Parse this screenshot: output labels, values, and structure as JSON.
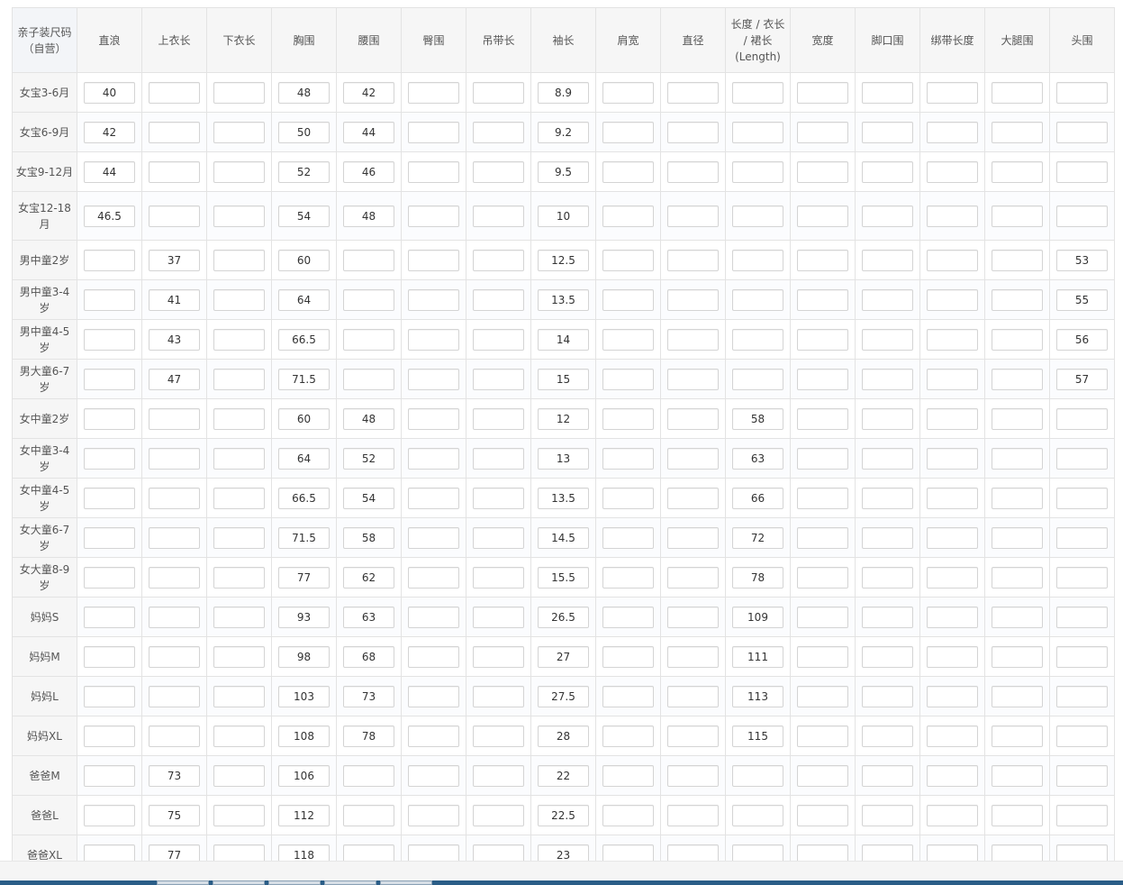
{
  "table": {
    "headers": [
      "亲子装尺码（自营）",
      "直浪",
      "上衣长",
      "下衣长",
      "胸围",
      "腰围",
      "臀围",
      "吊带长",
      "袖长",
      "肩宽",
      "直径",
      "长度 / 衣长 / 裙长 (Length)",
      "宽度",
      "脚口围",
      "绑带长度",
      "大腿围",
      "头围"
    ],
    "rows": [
      {
        "size": "女宝3-6月",
        "values": [
          "40",
          "",
          "",
          "48",
          "42",
          "",
          "",
          "8.9",
          "",
          "",
          "",
          "",
          "",
          "",
          "",
          ""
        ]
      },
      {
        "size": "女宝6-9月",
        "values": [
          "42",
          "",
          "",
          "50",
          "44",
          "",
          "",
          "9.2",
          "",
          "",
          "",
          "",
          "",
          "",
          "",
          ""
        ]
      },
      {
        "size": "女宝9-12月",
        "values": [
          "44",
          "",
          "",
          "52",
          "46",
          "",
          "",
          "9.5",
          "",
          "",
          "",
          "",
          "",
          "",
          "",
          ""
        ]
      },
      {
        "size": "女宝12-18月",
        "values": [
          "46.5",
          "",
          "",
          "54",
          "48",
          "",
          "",
          "10",
          "",
          "",
          "",
          "",
          "",
          "",
          "",
          ""
        ]
      },
      {
        "size": "男中童2岁",
        "values": [
          "",
          "37",
          "",
          "60",
          "",
          "",
          "",
          "12.5",
          "",
          "",
          "",
          "",
          "",
          "",
          "",
          "53"
        ]
      },
      {
        "size": "男中童3-4岁",
        "values": [
          "",
          "41",
          "",
          "64",
          "",
          "",
          "",
          "13.5",
          "",
          "",
          "",
          "",
          "",
          "",
          "",
          "55"
        ]
      },
      {
        "size": "男中童4-5岁",
        "values": [
          "",
          "43",
          "",
          "66.5",
          "",
          "",
          "",
          "14",
          "",
          "",
          "",
          "",
          "",
          "",
          "",
          "56"
        ]
      },
      {
        "size": "男大童6-7岁",
        "values": [
          "",
          "47",
          "",
          "71.5",
          "",
          "",
          "",
          "15",
          "",
          "",
          "",
          "",
          "",
          "",
          "",
          "57"
        ]
      },
      {
        "size": "女中童2岁",
        "values": [
          "",
          "",
          "",
          "60",
          "48",
          "",
          "",
          "12",
          "",
          "",
          "58",
          "",
          "",
          "",
          "",
          ""
        ]
      },
      {
        "size": "女中童3-4岁",
        "values": [
          "",
          "",
          "",
          "64",
          "52",
          "",
          "",
          "13",
          "",
          "",
          "63",
          "",
          "",
          "",
          "",
          ""
        ]
      },
      {
        "size": "女中童4-5岁",
        "values": [
          "",
          "",
          "",
          "66.5",
          "54",
          "",
          "",
          "13.5",
          "",
          "",
          "66",
          "",
          "",
          "",
          "",
          ""
        ]
      },
      {
        "size": "女大童6-7岁",
        "values": [
          "",
          "",
          "",
          "71.5",
          "58",
          "",
          "",
          "14.5",
          "",
          "",
          "72",
          "",
          "",
          "",
          "",
          ""
        ]
      },
      {
        "size": "女大童8-9岁",
        "values": [
          "",
          "",
          "",
          "77",
          "62",
          "",
          "",
          "15.5",
          "",
          "",
          "78",
          "",
          "",
          "",
          "",
          ""
        ]
      },
      {
        "size": "妈妈S",
        "values": [
          "",
          "",
          "",
          "93",
          "63",
          "",
          "",
          "26.5",
          "",
          "",
          "109",
          "",
          "",
          "",
          "",
          ""
        ]
      },
      {
        "size": "妈妈M",
        "values": [
          "",
          "",
          "",
          "98",
          "68",
          "",
          "",
          "27",
          "",
          "",
          "111",
          "",
          "",
          "",
          "",
          ""
        ]
      },
      {
        "size": "妈妈L",
        "values": [
          "",
          "",
          "",
          "103",
          "73",
          "",
          "",
          "27.5",
          "",
          "",
          "113",
          "",
          "",
          "",
          "",
          ""
        ]
      },
      {
        "size": "妈妈XL",
        "values": [
          "",
          "",
          "",
          "108",
          "78",
          "",
          "",
          "28",
          "",
          "",
          "115",
          "",
          "",
          "",
          "",
          ""
        ]
      },
      {
        "size": "爸爸M",
        "values": [
          "",
          "73",
          "",
          "106",
          "",
          "",
          "",
          "22",
          "",
          "",
          "",
          "",
          "",
          "",
          "",
          ""
        ]
      },
      {
        "size": "爸爸L",
        "values": [
          "",
          "75",
          "",
          "112",
          "",
          "",
          "",
          "22.5",
          "",
          "",
          "",
          "",
          "",
          "",
          "",
          ""
        ]
      },
      {
        "size": "爸爸XL",
        "values": [
          "",
          "77",
          "",
          "118",
          "",
          "",
          "",
          "23",
          "",
          "",
          "",
          "",
          "",
          "",
          "",
          ""
        ]
      }
    ]
  },
  "colors": {
    "header_bg": "#f6f6f6",
    "border": "#e3e3e3",
    "taskbar": "#2a5d87"
  }
}
